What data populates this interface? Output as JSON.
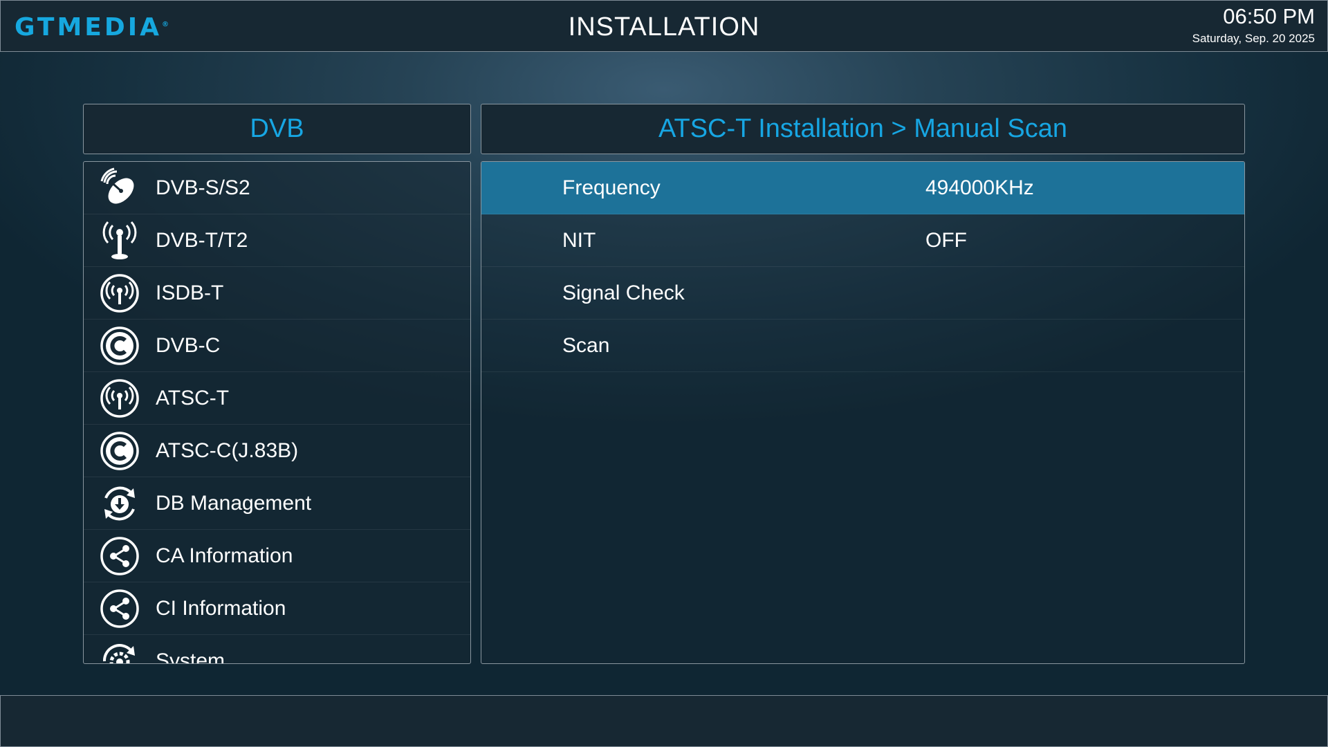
{
  "header": {
    "logo_text": "GTMEDIA",
    "logo_mark": "®",
    "title": "INSTALLATION",
    "time": "06:50 PM",
    "date": "Saturday, Sep. 20 2025"
  },
  "left_panel": {
    "title": "DVB",
    "items": [
      {
        "label": "DVB-S/S2",
        "icon": "satellite-dish-icon"
      },
      {
        "label": "DVB-T/T2",
        "icon": "antenna-icon"
      },
      {
        "label": "ISDB-T",
        "icon": "broadcast-icon"
      },
      {
        "label": "DVB-C",
        "icon": "cable-c-icon"
      },
      {
        "label": "ATSC-T",
        "icon": "broadcast-icon"
      },
      {
        "label": "ATSC-C(J.83B)",
        "icon": "cable-c-icon"
      },
      {
        "label": "DB Management",
        "icon": "database-sync-icon"
      },
      {
        "label": "CA Information",
        "icon": "share-icon"
      },
      {
        "label": "CI Information",
        "icon": "share-icon"
      },
      {
        "label": "System",
        "icon": "gear-icon"
      }
    ]
  },
  "right_panel": {
    "title": "ATSC-T Installation > Manual Scan",
    "rows": [
      {
        "label": "Frequency",
        "value": "494000KHz",
        "selected": true
      },
      {
        "label": "NIT",
        "value": "OFF"
      },
      {
        "label": "Signal Check",
        "value": ""
      },
      {
        "label": "Scan",
        "value": ""
      }
    ]
  },
  "colors": {
    "accent": "#17a6e3",
    "selected_row": "#1d7299",
    "bar_background": "#172833"
  }
}
